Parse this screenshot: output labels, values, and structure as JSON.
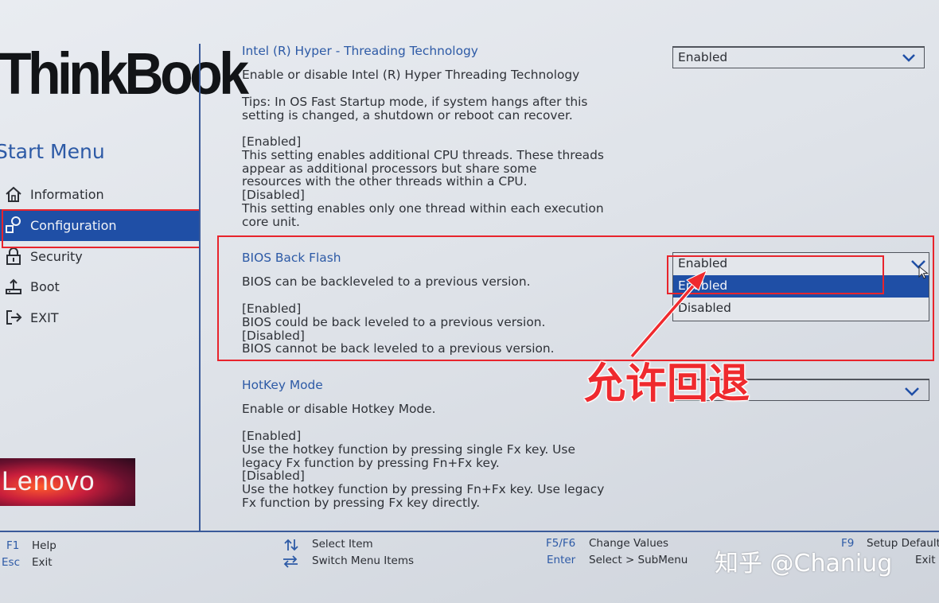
{
  "brand": "ThinkBook",
  "sidebar": {
    "title": "Start Menu",
    "items": [
      {
        "label": "Information",
        "icon": "home-icon"
      },
      {
        "label": "Configuration",
        "icon": "configuration-icon"
      },
      {
        "label": "Security",
        "icon": "lock-icon"
      },
      {
        "label": "Boot",
        "icon": "boot-icon"
      },
      {
        "label": "EXIT",
        "icon": "exit-icon"
      }
    ],
    "selected": "Configuration",
    "logo": "Lenovo"
  },
  "main": {
    "hyperthreading": {
      "title": "Intel (R) Hyper - Threading Technology",
      "value": "Enabled",
      "description": "Enable or disable Intel (R) Hyper Threading Technology",
      "tips": "Tips: In OS Fast Startup mode, if system hangs after this\nsetting is changed, a shutdown or reboot can recover.",
      "options_help": "[Enabled]\nThis setting enables additional CPU threads. These threads\nappear as additional processors but share some\nresources with the other threads within a CPU.\n[Disabled]\nThis setting enables only one thread within each execution\ncore unit."
    },
    "bios_back_flash": {
      "title": "BIOS Back Flash",
      "value": "Enabled",
      "description": "BIOS can be backleveled to a previous version.",
      "options_help": "[Enabled]\nBIOS could be back leveled to a previous version.\n[Disabled]\nBIOS cannot be back leveled to a previous version.",
      "options": [
        "Enabled",
        "Disabled"
      ],
      "highlighted": "Enabled"
    },
    "hotkey_mode": {
      "title": "HotKey Mode",
      "description": "Enable or disable Hotkey Mode.",
      "options_help": "[Enabled]\nUse the hotkey function by pressing single Fx key. Use\nlegacy Fx function by pressing Fn+Fx key.\n[Disabled]\nUse the hotkey function by pressing Fn+Fx key. Use legacy\nFx function by pressing Fx key directly."
    }
  },
  "annotation": "允许回退",
  "footer": {
    "f1_key": "F1",
    "f1_desc": "Help",
    "esc_key": "Esc",
    "esc_desc": "Exit",
    "arrows_ud_desc": "Select Item",
    "arrows_lr_desc": "Switch Menu Items",
    "f5f6_key": "F5/F6",
    "f5f6_desc": "Change Values",
    "enter_key": "Enter",
    "enter_desc": "Select > SubMenu",
    "f9_key": "F9",
    "f9_desc": "Setup Defaults",
    "f10_desc": "Exit"
  },
  "watermark": "知乎 @Chaniug",
  "colors": {
    "accent": "#1f4fa6",
    "heading": "#2d5aa6",
    "highlight_frame": "#e8242c",
    "annotation": "#ef2a2e"
  }
}
